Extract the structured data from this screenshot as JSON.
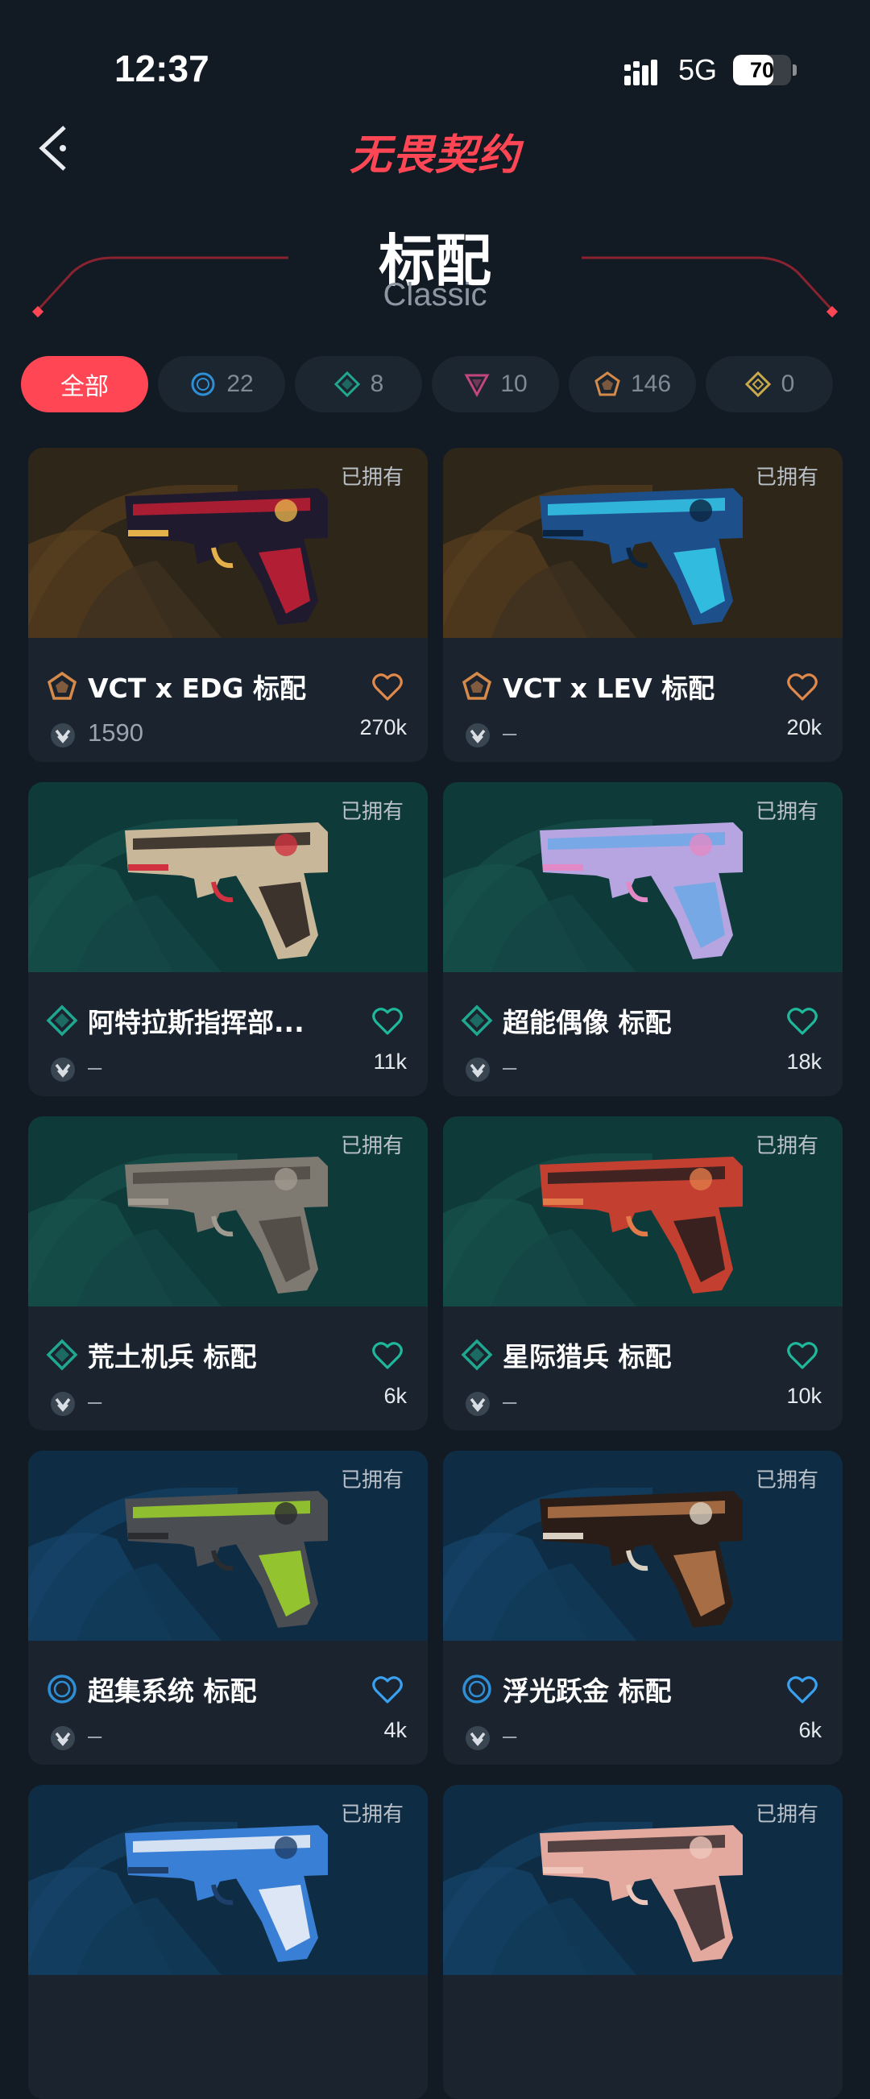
{
  "status": {
    "time": "12:37",
    "network": "5G",
    "battery": "70",
    "battery_level": 0.7
  },
  "header": {
    "logo": "无畏契约",
    "title": "标配",
    "subtitle": "Classic"
  },
  "filters": [
    {
      "label": "全部",
      "icon": "all"
    },
    {
      "label": "22",
      "icon": "select-tier-icon",
      "color": "#2f8fd6"
    },
    {
      "label": "8",
      "icon": "deluxe-tier-icon",
      "color": "#1fa88f"
    },
    {
      "label": "10",
      "icon": "premium-tier-icon",
      "color": "#c2457f"
    },
    {
      "label": "146",
      "icon": "exclusive-tier-icon",
      "color": "#d68a4a"
    },
    {
      "label": "0",
      "icon": "ultra-tier-icon",
      "color": "#c9a94b"
    }
  ],
  "owned_label": "已拥有",
  "skins": [
    {
      "name": "VCT x EDG 标配",
      "price": "1590",
      "likes": "270k",
      "tier": "exclusive",
      "theme": "brown"
    },
    {
      "name": "VCT x LEV 标配",
      "price": "–",
      "likes": "20k",
      "tier": "exclusive",
      "theme": "brown"
    },
    {
      "name": "阿特拉斯指挥部...",
      "price": "–",
      "likes": "11k",
      "tier": "deluxe",
      "theme": "teal"
    },
    {
      "name": "超能偶像 标配",
      "price": "–",
      "likes": "18k",
      "tier": "deluxe",
      "theme": "teal"
    },
    {
      "name": "荒土机兵 标配",
      "price": "–",
      "likes": "6k",
      "tier": "deluxe",
      "theme": "teal"
    },
    {
      "name": "星际猎兵 标配",
      "price": "–",
      "likes": "10k",
      "tier": "deluxe",
      "theme": "teal"
    },
    {
      "name": "超集系统 标配",
      "price": "–",
      "likes": "4k",
      "tier": "select",
      "theme": "blue"
    },
    {
      "name": "浮光跃金 标配",
      "price": "–",
      "likes": "6k",
      "tier": "select",
      "theme": "blue"
    },
    {
      "name": "",
      "price": "",
      "likes": "",
      "tier": "select",
      "theme": "blue"
    },
    {
      "name": "",
      "price": "",
      "likes": "",
      "tier": "select",
      "theme": "blue"
    }
  ],
  "colors": {
    "accent": "#ff4655",
    "exclusive": "#d68a4a",
    "deluxe": "#1fa88f",
    "select": "#2f8fd6",
    "heart_exclusive": "#e0894a",
    "heart_deluxe": "#1fb89a",
    "heart_select": "#3aa0f0"
  }
}
